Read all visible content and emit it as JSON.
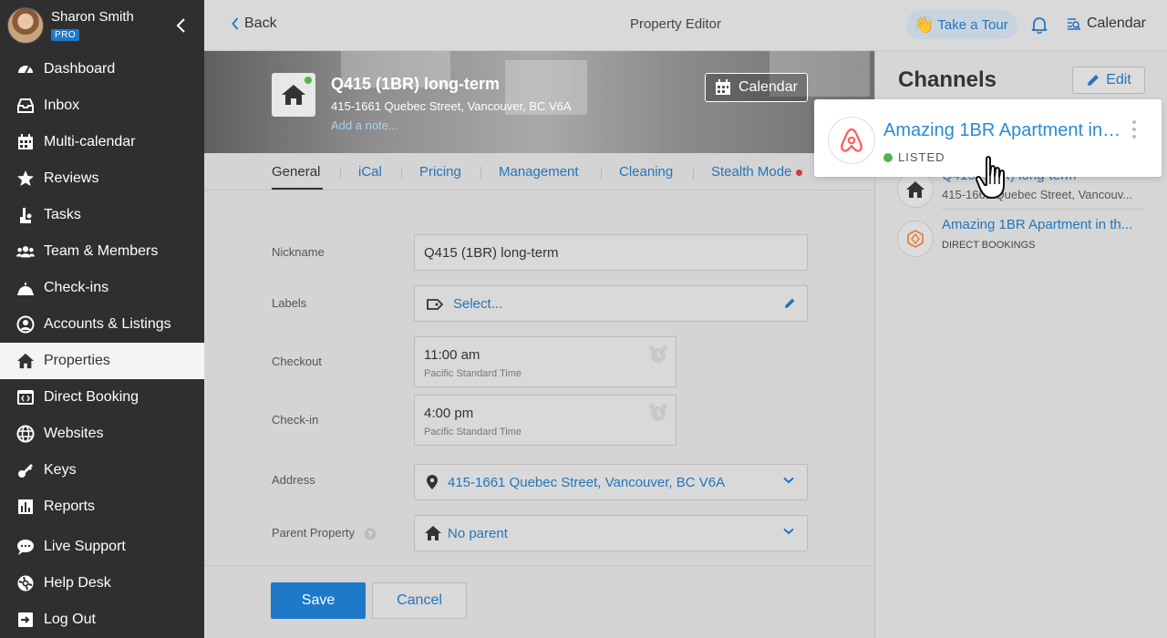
{
  "sidebar": {
    "user_name": "Sharon Smith",
    "badge": "PRO",
    "items": [
      {
        "label": "Dashboard",
        "icon": "dashboard-icon"
      },
      {
        "label": "Inbox",
        "icon": "inbox-icon"
      },
      {
        "label": "Multi-calendar",
        "icon": "calendar-icon"
      },
      {
        "label": "Reviews",
        "icon": "star-icon"
      },
      {
        "label": "Tasks",
        "icon": "tasks-icon"
      },
      {
        "label": "Team & Members",
        "icon": "team-icon"
      },
      {
        "label": "Check-ins",
        "icon": "bell-icon"
      },
      {
        "label": "Accounts & Listings",
        "icon": "account-icon"
      },
      {
        "label": "Properties",
        "icon": "home-icon"
      },
      {
        "label": "Direct Booking",
        "icon": "code-icon"
      },
      {
        "label": "Websites",
        "icon": "globe-icon"
      },
      {
        "label": "Keys",
        "icon": "key-icon"
      },
      {
        "label": "Reports",
        "icon": "reports-icon"
      },
      {
        "label": "Live Support",
        "icon": "chat-icon"
      },
      {
        "label": "Help Desk",
        "icon": "lifebuoy-icon"
      },
      {
        "label": "Log Out",
        "icon": "logout-icon"
      }
    ]
  },
  "header": {
    "back": "Back",
    "title": "Property Editor",
    "tour": "Take a Tour",
    "calendar": "Calendar"
  },
  "property": {
    "name": "Q415 (1BR) long-term",
    "address": "415-1661 Quebec Street, Vancouver, BC V6A",
    "add_note": "Add a note...",
    "calendar_btn": "Calendar"
  },
  "tabs": [
    "General",
    "iCal",
    "Pricing",
    "Management",
    "Cleaning",
    "Stealth Mode"
  ],
  "form": {
    "nickname_label": "Nickname",
    "nickname_value": "Q415 (1BR) long-term",
    "labels_label": "Labels",
    "labels_value": "Select...",
    "checkout_label": "Checkout",
    "checkout_time": "11:00 am",
    "checkout_tz": "Pacific Standard Time",
    "checkin_label": "Check-in",
    "checkin_time": "4:00 pm",
    "checkin_tz": "Pacific Standard Time",
    "address_label": "Address",
    "address_value": "415-1661 Quebec Street, Vancouver, BC V6A",
    "parent_label": "Parent Property",
    "parent_value": "No parent"
  },
  "footer": {
    "save": "Save",
    "cancel": "Cancel"
  },
  "channels": {
    "title": "Channels",
    "edit": "Edit",
    "highlight": {
      "title": "Amazing 1BR Apartment in ...",
      "status": "LISTED"
    },
    "items": [
      {
        "title": "Q415 (1BR) long-term",
        "sub": "415-1661 Quebec Street, Vancouv..."
      },
      {
        "title": "Amazing 1BR Apartment in th...",
        "sub": "DIRECT BOOKINGS"
      }
    ]
  },
  "colors": {
    "accent": "#1e79c8",
    "link": "#2375bb",
    "sidebar": "#2f2f2f",
    "airbnb": "#ff5a5f",
    "listed": "#55b34a"
  }
}
